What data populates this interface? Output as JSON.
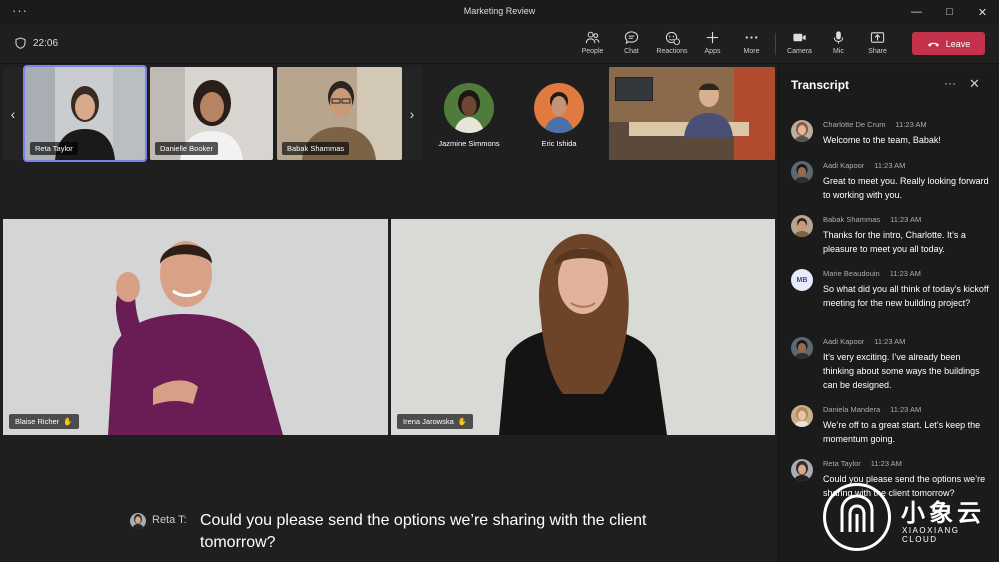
{
  "window": {
    "title": "Marketing Review",
    "menu_icon": "more-dots-icon"
  },
  "toolbar": {
    "timer": "22:06",
    "tools": [
      {
        "label": "People",
        "icon": "people-icon"
      },
      {
        "label": "Chat",
        "icon": "chat-icon"
      },
      {
        "label": "Reactions",
        "icon": "reactions-icon"
      },
      {
        "label": "Apps",
        "icon": "plus-icon"
      },
      {
        "label": "More",
        "icon": "more-icon"
      },
      {
        "label": "Camera",
        "icon": "camera-icon"
      },
      {
        "label": "Mic",
        "icon": "mic-icon"
      },
      {
        "label": "Share",
        "icon": "share-icon"
      }
    ],
    "leave_label": "Leave",
    "leave_color": "#c4314b"
  },
  "gallery": {
    "thumbnails": [
      {
        "name": "Reta Taylor",
        "selected": true
      },
      {
        "name": "Danielle Booker",
        "selected": false
      },
      {
        "name": "Babak Shammas",
        "selected": false
      }
    ],
    "avatars": [
      {
        "name": "Jazmine Simmons"
      },
      {
        "name": "Eric Ishida"
      }
    ]
  },
  "stage": {
    "tiles": [
      {
        "name": "Blaise Richer",
        "icon": "raised-hand-icon"
      },
      {
        "name": "Irena Jarowska",
        "icon": "raised-hand-icon"
      }
    ]
  },
  "caption": {
    "speaker": "Reta T:",
    "text": "Could you please send the options we’re sharing with the client tomorrow?"
  },
  "transcript": {
    "title": "Transcript",
    "entries": [
      {
        "name": "Charlotte De Crum",
        "time": "11:23 AM",
        "text": "Welcome to the team, Babak!"
      },
      {
        "name": "Aadi Kapoor",
        "time": "11:23 AM",
        "text": "Great to meet you. Really looking forward to working with you."
      },
      {
        "name": "Babak Shammas",
        "time": "11:23 AM",
        "text": "Thanks for the intro, Charlotte. It’s a pleasure to meet you all today."
      },
      {
        "name": "Marie Beaudouin",
        "time": "11:23 AM",
        "text": "So what did you all think of today’s kickoff meeting for the new building project?",
        "initials": "MB"
      },
      {
        "name": "Aadi Kapoor",
        "time": "11:23 AM",
        "text": "It’s very exciting. I’ve already been thinking about some ways the buildings can be designed."
      },
      {
        "name": "Daniela Mandera",
        "time": "11:23 AM",
        "text": "We’re off to a great start. Let’s keep the momentum going."
      },
      {
        "name": "Reta Taylor",
        "time": "11:23 AM",
        "text": "Could you please send the options we’re sharing with the client tomorrow?"
      }
    ]
  },
  "watermark": {
    "cn": "小象云",
    "en": "XIAOXIANG CLOUD"
  }
}
